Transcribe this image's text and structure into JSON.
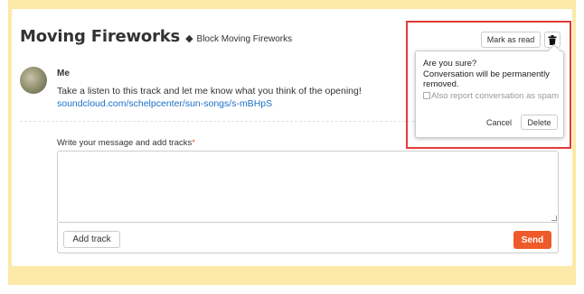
{
  "conversation": {
    "title": "Moving Fireworks",
    "block_label": "Block Moving Fireworks",
    "block_icon": "block-icon"
  },
  "message": {
    "sender": "Me",
    "text": "Take a listen to this track and let me know what you think of the opening!",
    "link": "soundcloud.com/schelpcenter/sun-songs/s-mBHpS"
  },
  "compose": {
    "label": "Write your message and add tracks",
    "required_mark": "*",
    "value": "",
    "add_track_label": "Add track",
    "send_label": "Send"
  },
  "toolbar": {
    "mark_as_read_label": "Mark as read",
    "delete_icon": "trash-icon"
  },
  "confirm": {
    "question": "Are you sure?",
    "message": "Conversation will be permanently removed.",
    "report_label": "Also report conversation as spam",
    "report_checked": false,
    "cancel_label": "Cancel",
    "delete_label": "Delete"
  },
  "colors": {
    "frame_background": "#fde9a8",
    "send_button": "#ef5a2a",
    "link": "#1c70c8",
    "highlight_box": "#e23a3a",
    "required_mark": "#e04a2b"
  }
}
